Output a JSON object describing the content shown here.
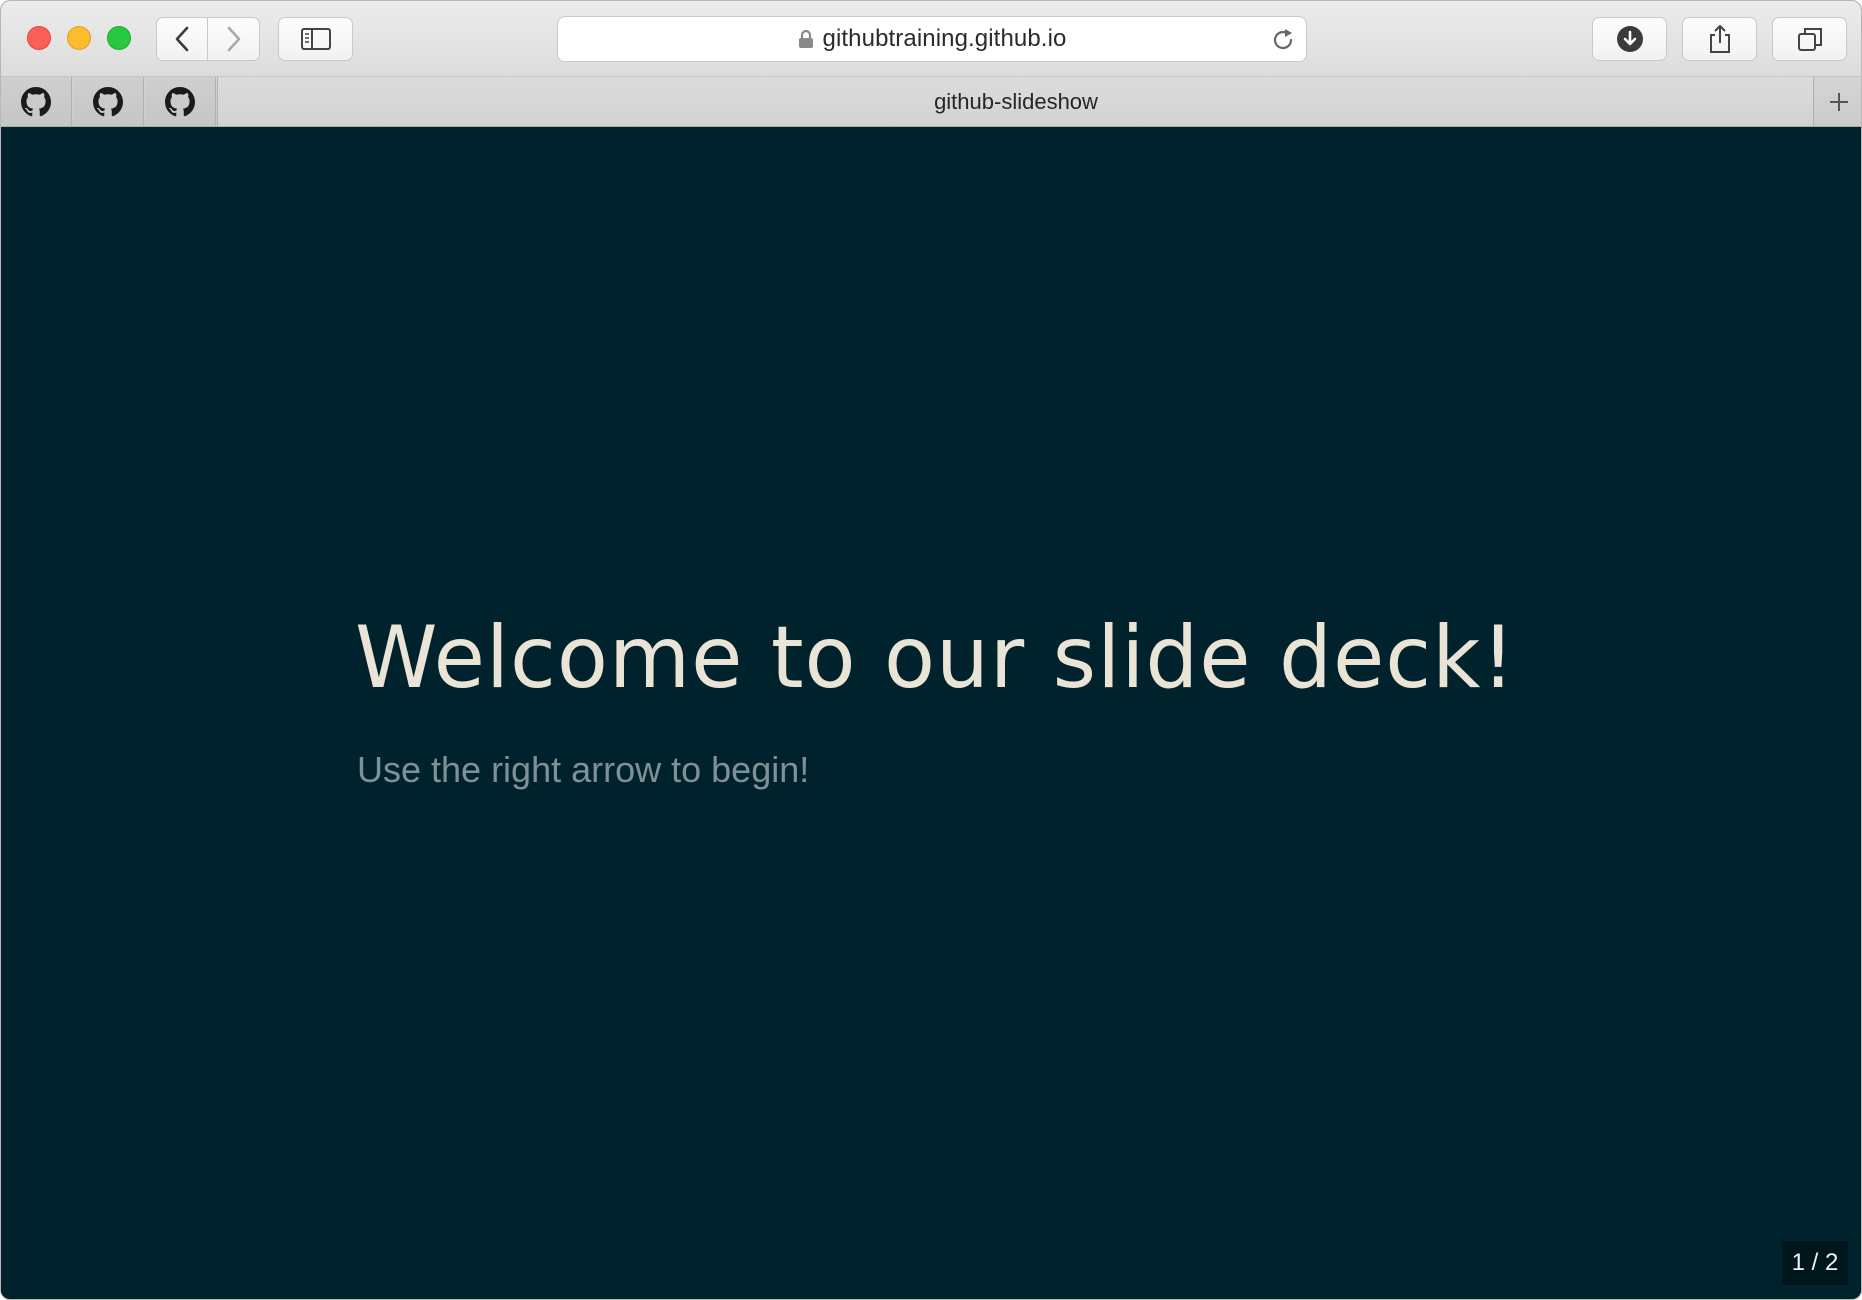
{
  "browser": {
    "url": "githubtraining.github.io",
    "active_tab_title": "github-slideshow",
    "pinned_tabs": [
      {
        "icon": "github-icon"
      },
      {
        "icon": "github-icon"
      },
      {
        "icon": "github-icon"
      }
    ],
    "toolbar_icons": {
      "back": "chevron-left-icon",
      "forward": "chevron-right-icon",
      "sidebar": "sidebar-icon",
      "lock": "lock-icon",
      "reload": "reload-icon",
      "download": "download-icon",
      "share": "share-icon",
      "tabs": "tab-overview-icon",
      "new_tab": "plus-icon"
    }
  },
  "slide": {
    "title": "Welcome to our slide deck!",
    "subtitle": "Use the right arrow to begin!",
    "page_counter": "1 / 2"
  },
  "colors": {
    "background": "#00222c",
    "title": "#eae4d6",
    "subtitle": "#7f9196"
  }
}
